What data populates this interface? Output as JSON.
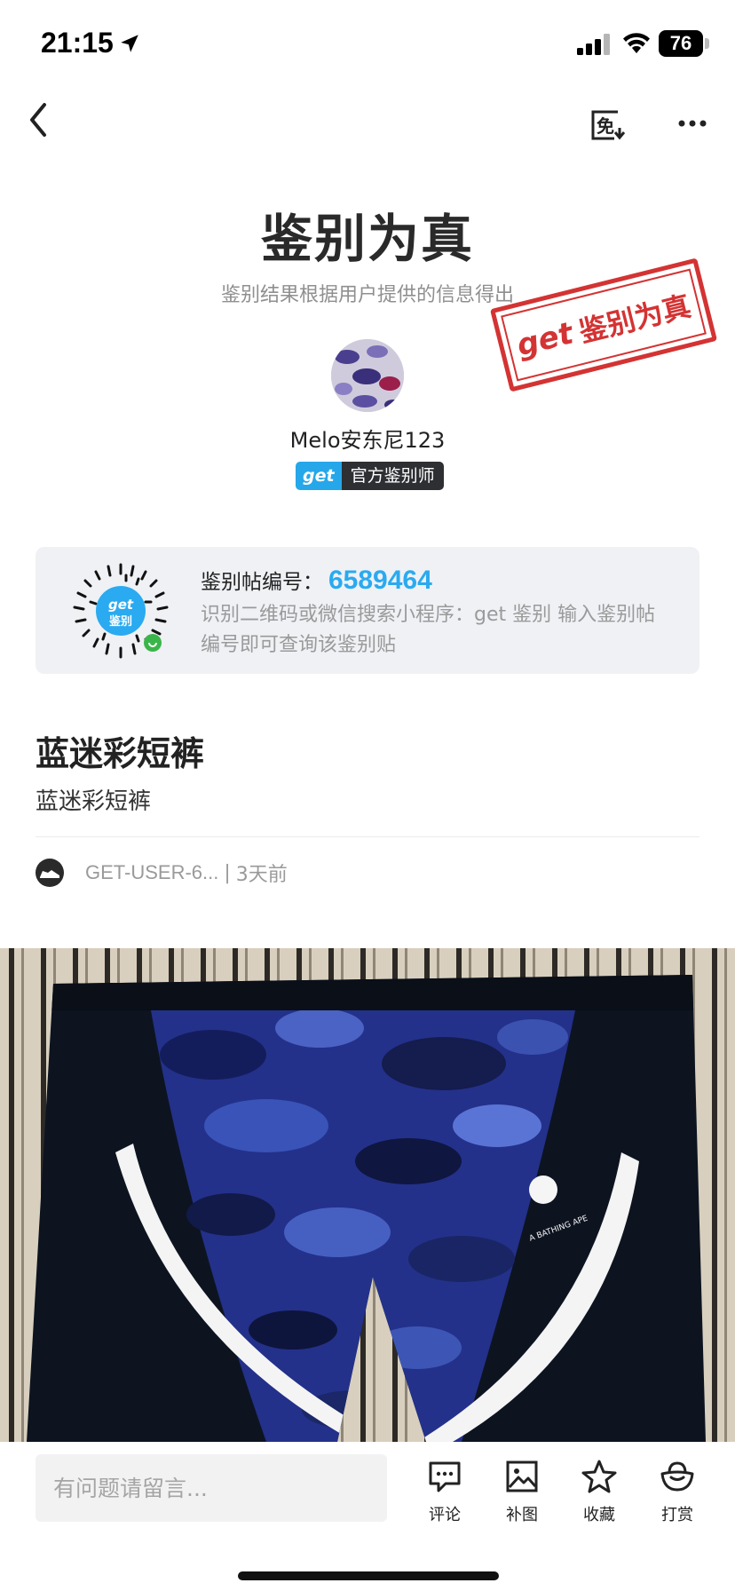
{
  "status_bar": {
    "time": "21:15",
    "battery": "76"
  },
  "header": {
    "back_icon": "chevron-left-icon",
    "exempt_icon": "exempt-icon",
    "more_icon": "more-dots-icon"
  },
  "verdict": {
    "title": "鉴别为真",
    "subtitle": "鉴别结果根据用户提供的信息得出",
    "stamp_brand": "get",
    "stamp_text": "鉴别为真",
    "stamp_color": "#d43333"
  },
  "appraiser": {
    "name": "Melo安东尼123",
    "badge_brand": "get",
    "badge_label": "官方鉴别师"
  },
  "qr_card": {
    "title": "鉴别帖编号：",
    "number": "6589464",
    "description": "识别二维码或微信搜索小程序：get 鉴别 输入鉴别帖编号即可查询该鉴别贴",
    "qr_brand": "get",
    "qr_label": "鉴别",
    "accent_color": "#2aaaf0"
  },
  "post": {
    "title": "蓝迷彩短裤",
    "body": "蓝迷彩短裤",
    "author": "GET-USER-6...",
    "separator": "|",
    "time": "3天前"
  },
  "photo": {
    "brand_text": "A BATHING APE"
  },
  "bottom_bar": {
    "comment_placeholder": "有问题请留言...",
    "actions": [
      {
        "label": "评论",
        "icon": "comment-icon"
      },
      {
        "label": "补图",
        "icon": "image-icon"
      },
      {
        "label": "收藏",
        "icon": "star-icon"
      },
      {
        "label": "打赏",
        "icon": "ingot-icon"
      }
    ]
  }
}
